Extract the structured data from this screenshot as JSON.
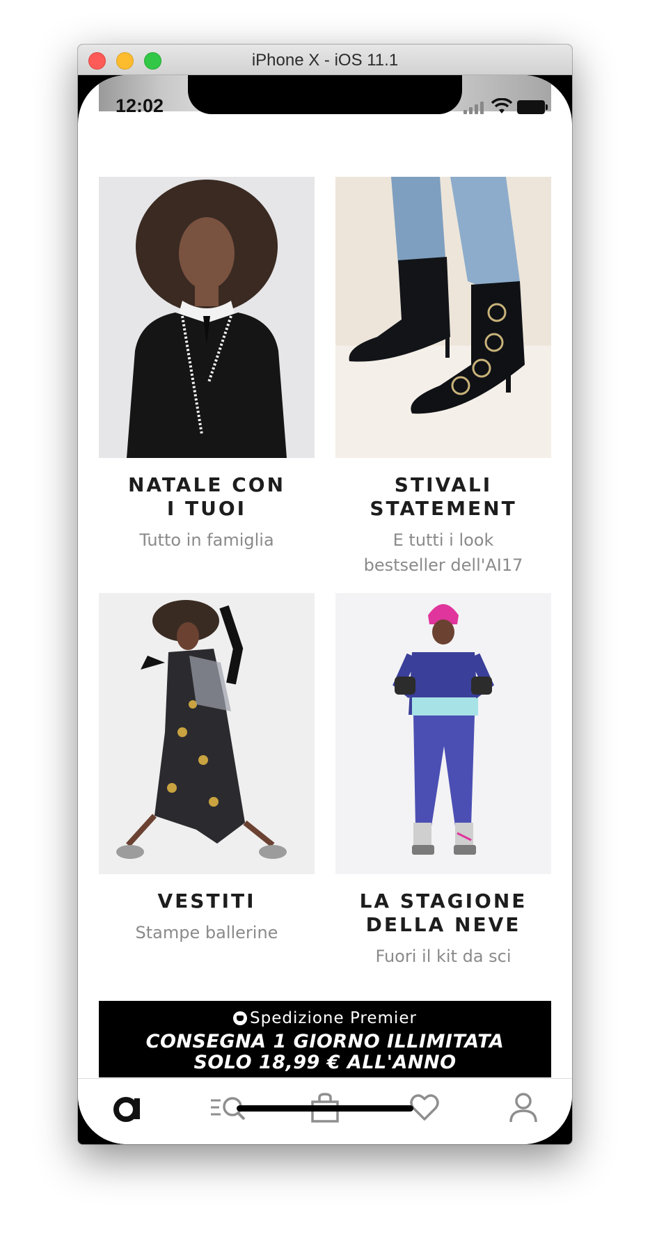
{
  "window": {
    "title": "iPhone X - iOS 11.1"
  },
  "status_bar": {
    "time": "12:02"
  },
  "tiles": [
    {
      "title": "NATALE CON\nI TUOI",
      "subtitle": "Tutto in famiglia"
    },
    {
      "title": "STIVALI STATEMENT",
      "subtitle": "E tutti i look\nbestseller dell'AI17"
    },
    {
      "title": "VESTITI",
      "subtitle": "Stampe ballerine"
    },
    {
      "title": "LA STAGIONE\nDELLA NEVE",
      "subtitle": "Fuori il kit da sci"
    }
  ],
  "promo": {
    "heading": "Spedizione Premier",
    "line1": "CONSEGNA 1 GIORNO ILLIMITATA",
    "line2": "SOLO 18,99 € ALL'ANNO"
  },
  "tabbar": {
    "items": [
      {
        "icon": "asos-logo-icon",
        "active": true
      },
      {
        "icon": "search-menu-icon",
        "active": false
      },
      {
        "icon": "bag-icon",
        "active": false
      },
      {
        "icon": "heart-icon",
        "active": false
      },
      {
        "icon": "profile-icon",
        "active": false
      }
    ]
  },
  "colors": {
    "accent": "#000000",
    "muted": "#8a8a8a"
  }
}
